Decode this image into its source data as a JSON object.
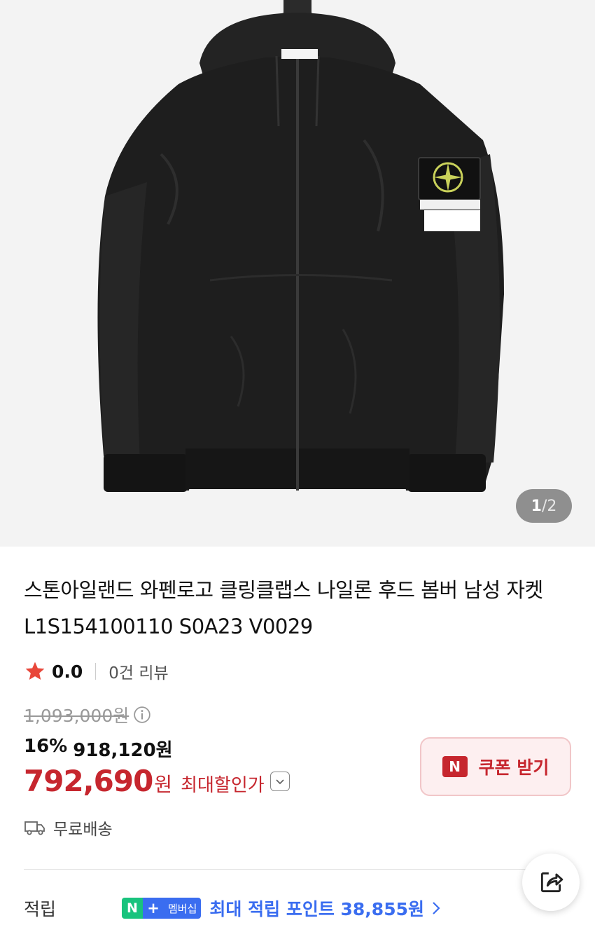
{
  "gallery": {
    "current": "1",
    "separator": "/",
    "total": "2"
  },
  "product": {
    "title": "스톤아일랜드 와펜로고 클링클랩스 나일론 후드 봄버 남성 자켓 L1S154100110 S0A23 V0029"
  },
  "rating": {
    "score": "0.0",
    "reviews": "0건 리뷰",
    "star_color": "#e8473a"
  },
  "price": {
    "original": "1,093,000원",
    "discount_pct": "16%",
    "discounted": "918,120원",
    "final": "792,690",
    "final_unit": "원",
    "max_label": "최대할인가",
    "accent_color": "#c6262e"
  },
  "coupon": {
    "badge": "N",
    "label": "쿠폰 받기"
  },
  "shipping": {
    "label": "무료배송"
  },
  "points": {
    "label": "적립",
    "badge_n": "N",
    "badge_plus": "+",
    "badge_member": "멤버십",
    "text": "최대 적립 포인트 38,855원",
    "accent_color": "#3a6df0"
  },
  "icons": {
    "share": "share-icon",
    "truck": "truck-icon",
    "info": "info-icon",
    "star": "star-icon"
  }
}
